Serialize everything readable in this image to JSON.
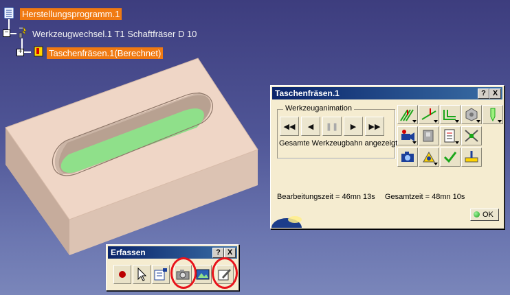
{
  "tree": {
    "root_label": "Herstellungsprogramm.1",
    "toolchange_label": "Werkzeugwechsel.1  T1 Schaftfräser D 10",
    "operation_label": "Taschenfräsen.1(Berechnet)"
  },
  "dialog": {
    "title": "Taschenfräsen.1",
    "help_label": "?",
    "close_label": "X",
    "anim_group_label": "Werkzeuganimation",
    "anim_buttons": [
      "◀◀",
      "◀",
      "❚❚",
      "▶",
      "▶▶"
    ],
    "path_mode_label": "Gesamte Werkzeugbahn angezeigt",
    "machining_time": "Bearbeitungszeit = 46mn 13s",
    "total_time": "Gesamtzeit = 48mn 10s",
    "ok_label": "OK"
  },
  "capture_toolbar": {
    "title": "Erfassen",
    "help_label": "?",
    "close_label": "X"
  },
  "colors": {
    "tree_highlight": "#f07a12",
    "part_top": "#efd6c6",
    "pocket_floor": "#8fe08a",
    "annotation_ring": "#e8131b"
  }
}
